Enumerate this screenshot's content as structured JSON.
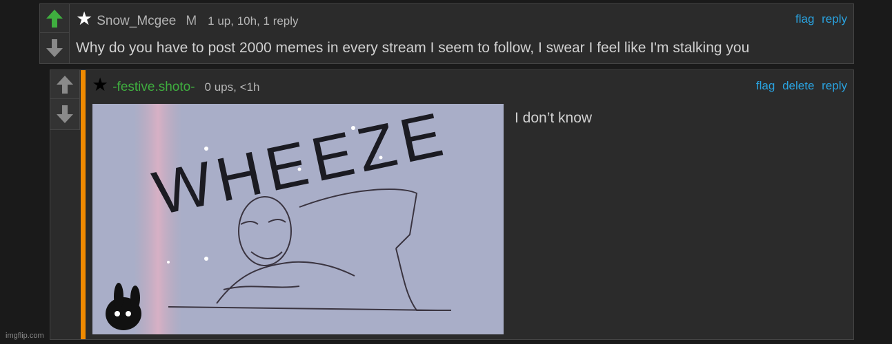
{
  "comments": [
    {
      "star_glyph": "★",
      "username": "Snow_Mcgee",
      "badge": "M",
      "stats": "1 up, 10h, 1 reply",
      "actions": [
        "flag",
        "reply"
      ],
      "text": "Why do you have to post 2000 memes in every stream I seem to follow, I swear I feel like I'm stalking you",
      "upvoted": true
    },
    {
      "star_glyph": "★",
      "username": "-festive.shoto-",
      "stats": "0 ups, <1h",
      "actions": [
        "flag",
        "delete",
        "reply"
      ],
      "text": "I don’t know",
      "image_caption_text": "WHEEZE",
      "upvoted": false
    }
  ],
  "colors": {
    "upvote_active": "#3fae3f",
    "vote_inactive": "#8a8a8a",
    "link": "#2aa3e0",
    "username_green": "#3fae3f",
    "accent_orange": "#f08a00"
  },
  "icons": [
    "arrow-up-icon",
    "arrow-down-icon",
    "star-icon"
  ],
  "watermark": "imgflip.com"
}
